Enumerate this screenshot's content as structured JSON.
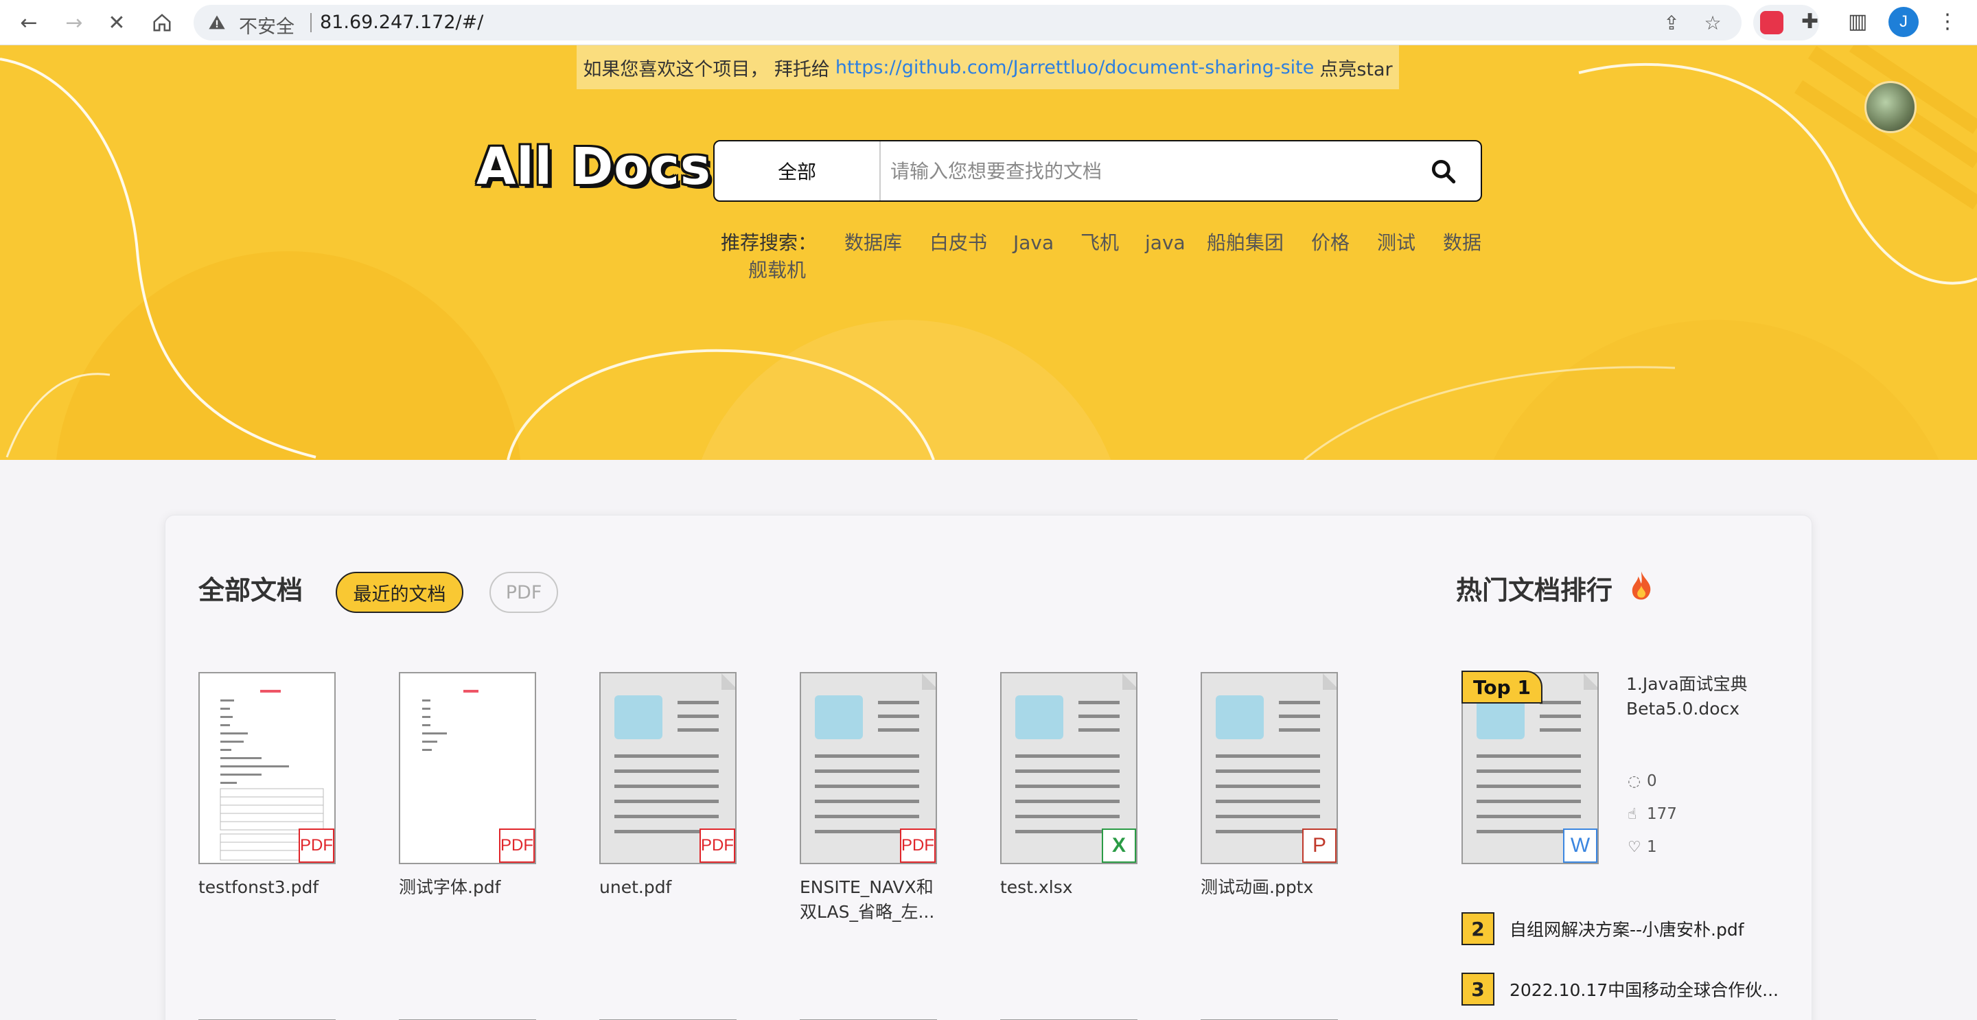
{
  "browser": {
    "security_label": "不安全",
    "url": "81.69.247.172/#/"
  },
  "banner": {
    "notice_prefix": "如果您喜欢这个项目， 拜托给",
    "notice_link": "https://github.com/Jarrettluo/document-sharing-site",
    "notice_suffix": "点亮star",
    "logo": "All Docs",
    "accent_color": "#f9c833"
  },
  "search": {
    "category": "全部",
    "placeholder": "请输入您想要查找的文档"
  },
  "recommend": {
    "label": "推荐搜索：",
    "items": [
      "数据库",
      "白皮书",
      "Java",
      "飞机",
      "java",
      "船舶集团",
      "价格",
      "测试",
      "数据"
    ],
    "second_line_item": "舰载机"
  },
  "docs_section": {
    "title": "全部文档",
    "filters": [
      "最近的文档",
      "PDF"
    ],
    "items": [
      {
        "name": "testfonst3.pdf",
        "type": "PDF"
      },
      {
        "name": "测试字体.pdf",
        "type": "PDF"
      },
      {
        "name": "unet.pdf",
        "type": "PDF"
      },
      {
        "name_line1": "ENSITE_NAVX和",
        "name_line2": "双LAS_省略_左...",
        "type": "PDF"
      },
      {
        "name": "test.xlsx",
        "type": "X"
      },
      {
        "name": "测试动画.pptx",
        "type": "P"
      }
    ]
  },
  "hot": {
    "title": "热门文档排行",
    "top_label": "Top 1",
    "top_name_line1": "1.Java面试宝典",
    "top_name_line2": "Beta5.0.docx",
    "top_type": "W",
    "stats": {
      "comments": "0",
      "views": "177",
      "likes": "1"
    },
    "ranks": [
      {
        "num": "2",
        "name": "自组网解决方案--小唐安朴.pdf"
      },
      {
        "num": "3",
        "name": "2022.10.17中国移动全球合作伙..."
      }
    ]
  }
}
